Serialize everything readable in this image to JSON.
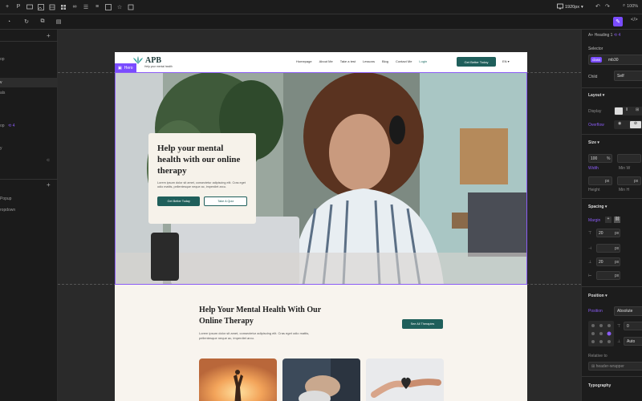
{
  "toolbar": {
    "page_label": "P",
    "width_label": "1920px",
    "zoom_label": "100%"
  },
  "left_panel": {
    "items": [
      {
        "label": "op"
      },
      {
        "label": "v"
      },
      {
        "label": "als"
      },
      {
        "label": "op"
      },
      {
        "label": "y"
      },
      {
        "label": "Popup"
      },
      {
        "label": "ropdown"
      }
    ],
    "badge": "4"
  },
  "site": {
    "logo": {
      "name": "APB",
      "tagline": "Help your mental health"
    },
    "nav": [
      "Homepage",
      "About Me",
      "Take a test",
      "Lessons",
      "Blog",
      "Contact Me",
      "Login"
    ],
    "nav_button": "Get Better Today",
    "lang": "EN",
    "hero_label": "Hero",
    "hero": {
      "title": "Help your mental health with our online therapy",
      "desc": "Lorem ipsum dolor sit amet, consectetur adipiscing elit. Cras eget odio mattis, pellentesque neque ac, imperdiet arcu.",
      "primary": "Get Better Today",
      "secondary": "Take A Quiz"
    },
    "section2": {
      "title": "Help Your Mental Health With Our Online Therapy",
      "desc": "Lorem ipsum dolor sit amet, consectetur adipiscing elit. Cras eget odio mattis, pellentesque neque ac, imperdiet arcu.",
      "button": "See All Therapies"
    }
  },
  "right_panel": {
    "element": "Heading 1",
    "element_badge": "4",
    "selector_label": "Selector",
    "class_badge": "class",
    "class_name": "mb30",
    "child_label": "Child",
    "child_value": "Self",
    "layout": "Layout",
    "display": "Display",
    "overflow": "Overflow",
    "size": "Size",
    "width_value": "100",
    "width_unit": "%",
    "width_label": "Width",
    "minw_label": "Min W",
    "height_unit": "px",
    "height_label": "Height",
    "minh_label": "Min H",
    "spacing": "Spacing",
    "margin_label": "Margin",
    "margin_top": "20",
    "margin_bottom": "20",
    "unit_px": "px",
    "position": "Position",
    "position_label": "Position",
    "position_value": "Absolute",
    "pos_top": "0",
    "pos_auto": "Auto",
    "relative_to": "Relative to",
    "relative_value": "header-wrapper",
    "typography": "Typography"
  }
}
